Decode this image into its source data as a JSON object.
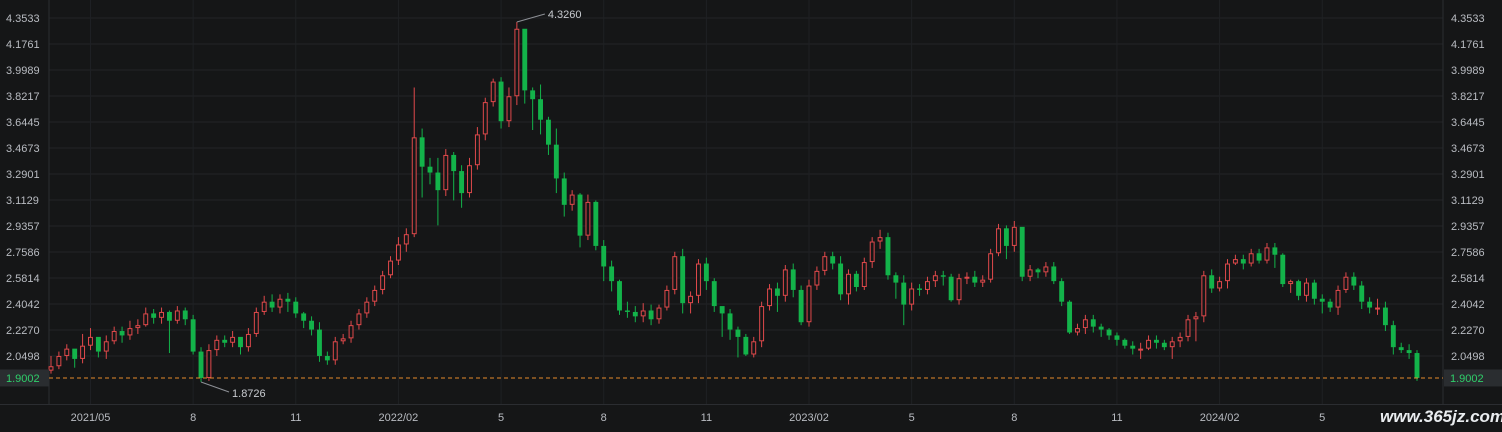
{
  "chart_data": {
    "type": "candlestick",
    "interval": "weekly",
    "y_ticks": [
      "4.3533",
      "4.1761",
      "3.9989",
      "3.8217",
      "3.6445",
      "3.4673",
      "3.2901",
      "3.1129",
      "2.9357",
      "2.7586",
      "2.5814",
      "2.4042",
      "2.2270",
      "2.0498"
    ],
    "ylim": [
      1.82,
      4.41
    ],
    "x_ticks": [
      "2021/05",
      "8",
      "11",
      "2022/02",
      "5",
      "8",
      "11",
      "2023/02",
      "5",
      "8",
      "11",
      "2024/02",
      "5"
    ],
    "high_annotation": "4.3260",
    "low_annotation": "1.8726",
    "current_price": "1.9002",
    "up_color": "#e0494b",
    "down_color": "#13b34a",
    "price_line_color": "#e58a2b",
    "grid": true,
    "watermark": "www.365jz.com",
    "closes": [
      1.98,
      2.05,
      2.1,
      2.03,
      2.12,
      2.18,
      2.08,
      2.15,
      2.22,
      2.19,
      2.24,
      2.26,
      2.34,
      2.31,
      2.35,
      2.29,
      2.36,
      2.3,
      2.08,
      1.9,
      2.09,
      2.16,
      2.14,
      2.18,
      2.11,
      2.2,
      2.35,
      2.42,
      2.38,
      2.44,
      2.42,
      2.34,
      2.29,
      2.23,
      2.05,
      2.02,
      2.15,
      2.17,
      2.26,
      2.34,
      2.42,
      2.5,
      2.6,
      2.7,
      2.81,
      2.88,
      3.54,
      3.34,
      3.3,
      3.18,
      3.42,
      3.31,
      3.16,
      3.35,
      3.56,
      3.78,
      3.92,
      3.65,
      3.82,
      4.28,
      3.86,
      3.8,
      3.66,
      3.49,
      3.26,
      3.08,
      3.15,
      2.87,
      3.1,
      2.8,
      2.66,
      2.56,
      2.36,
      2.35,
      2.32,
      2.36,
      2.3,
      2.38,
      2.5,
      2.73,
      2.41,
      2.46,
      2.68,
      2.56,
      2.39,
      2.34,
      2.23,
      2.18,
      2.06,
      2.15,
      2.39,
      2.51,
      2.46,
      2.64,
      2.5,
      2.28,
      2.53,
      2.63,
      2.73,
      2.68,
      2.47,
      2.61,
      2.52,
      2.69,
      2.83,
      2.86,
      2.6,
      2.55,
      2.4,
      2.51,
      2.5,
      2.56,
      2.6,
      2.59,
      2.43,
      2.58,
      2.59,
      2.55,
      2.57,
      2.75,
      2.92,
      2.8,
      2.93,
      2.59,
      2.64,
      2.62,
      2.66,
      2.56,
      2.42,
      2.21,
      2.24,
      2.3,
      2.25,
      2.23,
      2.19,
      2.16,
      2.12,
      2.1,
      2.1,
      2.16,
      2.14,
      2.11,
      2.15,
      2.18,
      2.3,
      2.32,
      2.6,
      2.51,
      2.56,
      2.68,
      2.71,
      2.68,
      2.75,
      2.7,
      2.79,
      2.74,
      2.54,
      2.56,
      2.46,
      2.55,
      2.44,
      2.42,
      2.38,
      2.5,
      2.59,
      2.53,
      2.42,
      2.38,
      2.38,
      2.26,
      2.11,
      2.09,
      2.07,
      1.9
    ],
    "highs": [
      2.05,
      2.08,
      2.13,
      2.09,
      2.2,
      2.24,
      2.15,
      2.19,
      2.25,
      2.25,
      2.29,
      2.3,
      2.38,
      2.37,
      2.38,
      2.36,
      2.39,
      2.38,
      2.33,
      2.11,
      2.13,
      2.19,
      2.19,
      2.22,
      2.17,
      2.24,
      2.38,
      2.46,
      2.47,
      2.47,
      2.48,
      2.45,
      2.35,
      2.32,
      2.28,
      2.08,
      2.18,
      2.2,
      2.29,
      2.37,
      2.45,
      2.53,
      2.63,
      2.73,
      2.86,
      2.92,
      3.88,
      3.6,
      3.4,
      3.4,
      3.46,
      3.44,
      3.35,
      3.4,
      3.61,
      3.81,
      3.94,
      3.95,
      3.88,
      4.326,
      4.24,
      3.88,
      3.9,
      3.68,
      3.6,
      3.3,
      3.18,
      3.16,
      3.15,
      3.11,
      2.84,
      2.7,
      2.57,
      2.42,
      2.39,
      2.41,
      2.4,
      2.4,
      2.53,
      2.76,
      2.78,
      2.49,
      2.71,
      2.72,
      2.58,
      2.37,
      2.37,
      2.25,
      2.2,
      2.18,
      2.42,
      2.54,
      2.55,
      2.67,
      2.68,
      2.53,
      2.57,
      2.66,
      2.76,
      2.76,
      2.73,
      2.64,
      2.63,
      2.72,
      2.86,
      2.91,
      2.89,
      2.62,
      2.6,
      2.55,
      2.54,
      2.59,
      2.63,
      2.63,
      2.61,
      2.61,
      2.62,
      2.63,
      2.6,
      2.78,
      2.95,
      2.94,
      2.97,
      2.92,
      2.67,
      2.65,
      2.69,
      2.69,
      2.58,
      2.43,
      2.27,
      2.33,
      2.33,
      2.27,
      2.24,
      2.21,
      2.17,
      2.15,
      2.14,
      2.19,
      2.19,
      2.16,
      2.18,
      2.21,
      2.33,
      2.35,
      2.63,
      2.64,
      2.59,
      2.71,
      2.74,
      2.74,
      2.78,
      2.78,
      2.82,
      2.82,
      2.75,
      2.57,
      2.57,
      2.58,
      2.57,
      2.47,
      2.44,
      2.53,
      2.62,
      2.62,
      2.56,
      2.45,
      2.44,
      2.42,
      2.29,
      2.14,
      2.13,
      2.09
    ],
    "lows": [
      1.93,
      1.96,
      2.02,
      1.97,
      2.0,
      2.09,
      2.04,
      2.03,
      2.13,
      2.14,
      2.16,
      2.2,
      2.25,
      2.27,
      2.27,
      2.07,
      2.27,
      2.26,
      2.06,
      1.873,
      1.88,
      2.05,
      2.11,
      2.11,
      2.06,
      2.08,
      2.18,
      2.33,
      2.35,
      2.34,
      2.35,
      2.31,
      2.24,
      2.19,
      2.01,
      1.99,
      1.99,
      2.13,
      2.14,
      2.23,
      2.31,
      2.39,
      2.47,
      2.58,
      2.67,
      2.76,
      2.86,
      3.13,
      3.22,
      2.94,
      3.14,
      3.11,
      3.06,
      3.13,
      3.32,
      3.52,
      3.75,
      3.6,
      3.61,
      3.76,
      3.77,
      3.59,
      3.56,
      3.42,
      3.16,
      3.0,
      3.04,
      2.79,
      2.84,
      2.77,
      2.56,
      2.49,
      2.33,
      2.31,
      2.28,
      2.28,
      2.26,
      2.27,
      2.36,
      2.47,
      2.34,
      2.34,
      2.41,
      2.5,
      2.35,
      2.18,
      2.16,
      2.04,
      2.05,
      2.04,
      2.11,
      2.36,
      2.35,
      2.42,
      2.45,
      2.26,
      2.25,
      2.5,
      2.6,
      2.64,
      2.43,
      2.4,
      2.49,
      2.5,
      2.65,
      2.78,
      2.57,
      2.44,
      2.26,
      2.36,
      2.46,
      2.47,
      2.52,
      2.53,
      2.42,
      2.4,
      2.54,
      2.52,
      2.52,
      2.55,
      2.73,
      2.71,
      2.76,
      2.56,
      2.56,
      2.58,
      2.59,
      2.54,
      2.39,
      2.2,
      2.19,
      2.2,
      2.21,
      2.18,
      2.16,
      2.12,
      2.1,
      2.06,
      2.03,
      2.09,
      2.1,
      2.09,
      2.03,
      2.11,
      2.15,
      2.15,
      2.28,
      2.48,
      2.49,
      2.51,
      2.67,
      2.64,
      2.66,
      2.68,
      2.68,
      2.65,
      2.52,
      2.48,
      2.43,
      2.42,
      2.4,
      2.34,
      2.35,
      2.33,
      2.48,
      2.5,
      2.37,
      2.34,
      2.33,
      2.22,
      2.06,
      2.07,
      2.03,
      1.88
    ]
  }
}
